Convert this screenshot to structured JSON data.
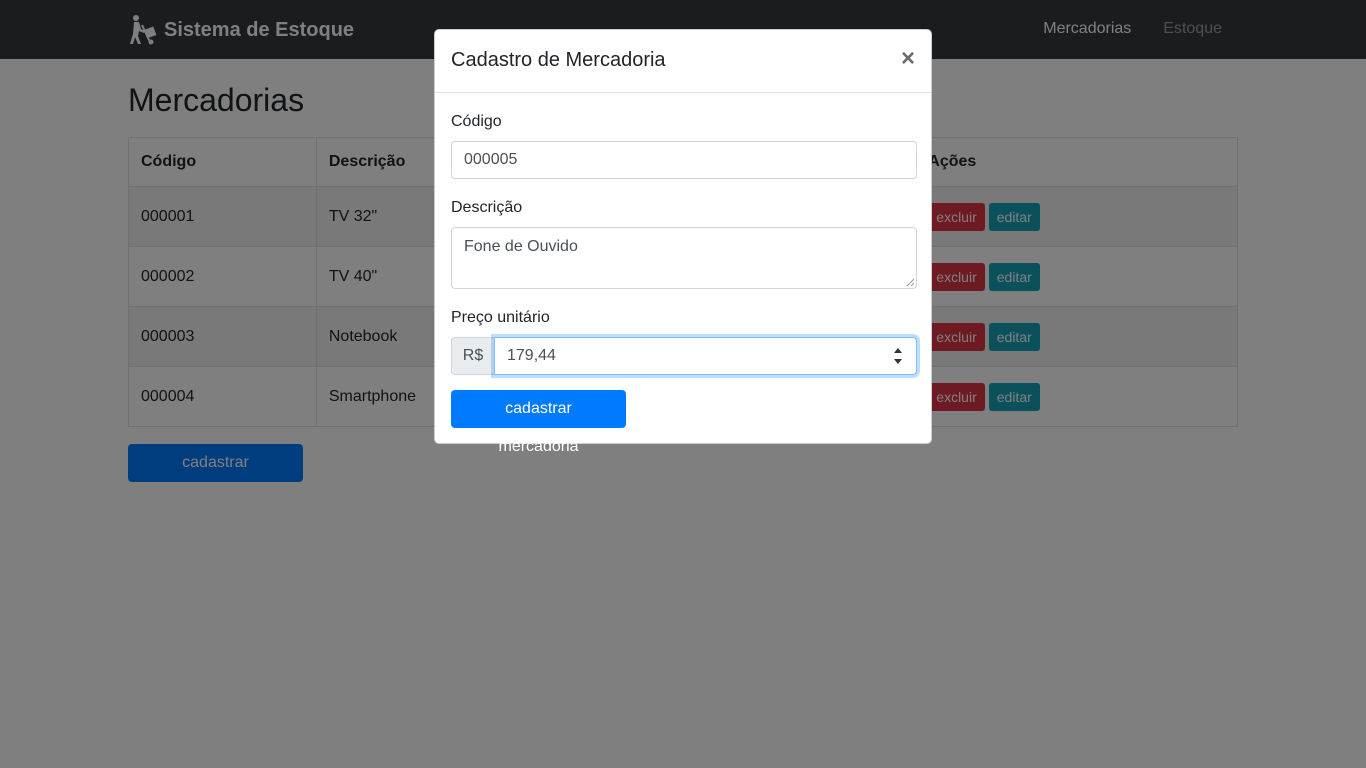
{
  "navbar": {
    "brand": "Sistema de Estoque",
    "brand_icon": "hand-truck-icon",
    "links": [
      "Mercadorias",
      "Estoque"
    ]
  },
  "page": {
    "title": "Mercadorias",
    "table": {
      "headers": [
        "Código",
        "Descrição",
        "",
        "Ações"
      ],
      "rows": [
        {
          "codigo": "000001",
          "descricao": "TV 32\""
        },
        {
          "codigo": "000002",
          "descricao": "TV 40\""
        },
        {
          "codigo": "000003",
          "descricao": "Notebook"
        },
        {
          "codigo": "000004",
          "descricao": "Smartphone"
        }
      ],
      "delete_label": "excluir",
      "edit_label": "editar"
    },
    "add_button": "cadastrar mercadoria"
  },
  "modal": {
    "title": "Cadastro de Mercadoria",
    "close": "×",
    "fields": {
      "codigo_label": "Código",
      "codigo_value": "000005",
      "descricao_label": "Descrição",
      "descricao_value": "Fone de Ouvido",
      "preco_label": "Preço unitário",
      "preco_prefix": "R$",
      "preco_value": "179,44"
    },
    "submit": "cadastrar mercadoria"
  },
  "colors": {
    "navbar": "#343a40",
    "primary": "#007bff",
    "danger": "#dc3545",
    "info": "#17a2b8"
  }
}
